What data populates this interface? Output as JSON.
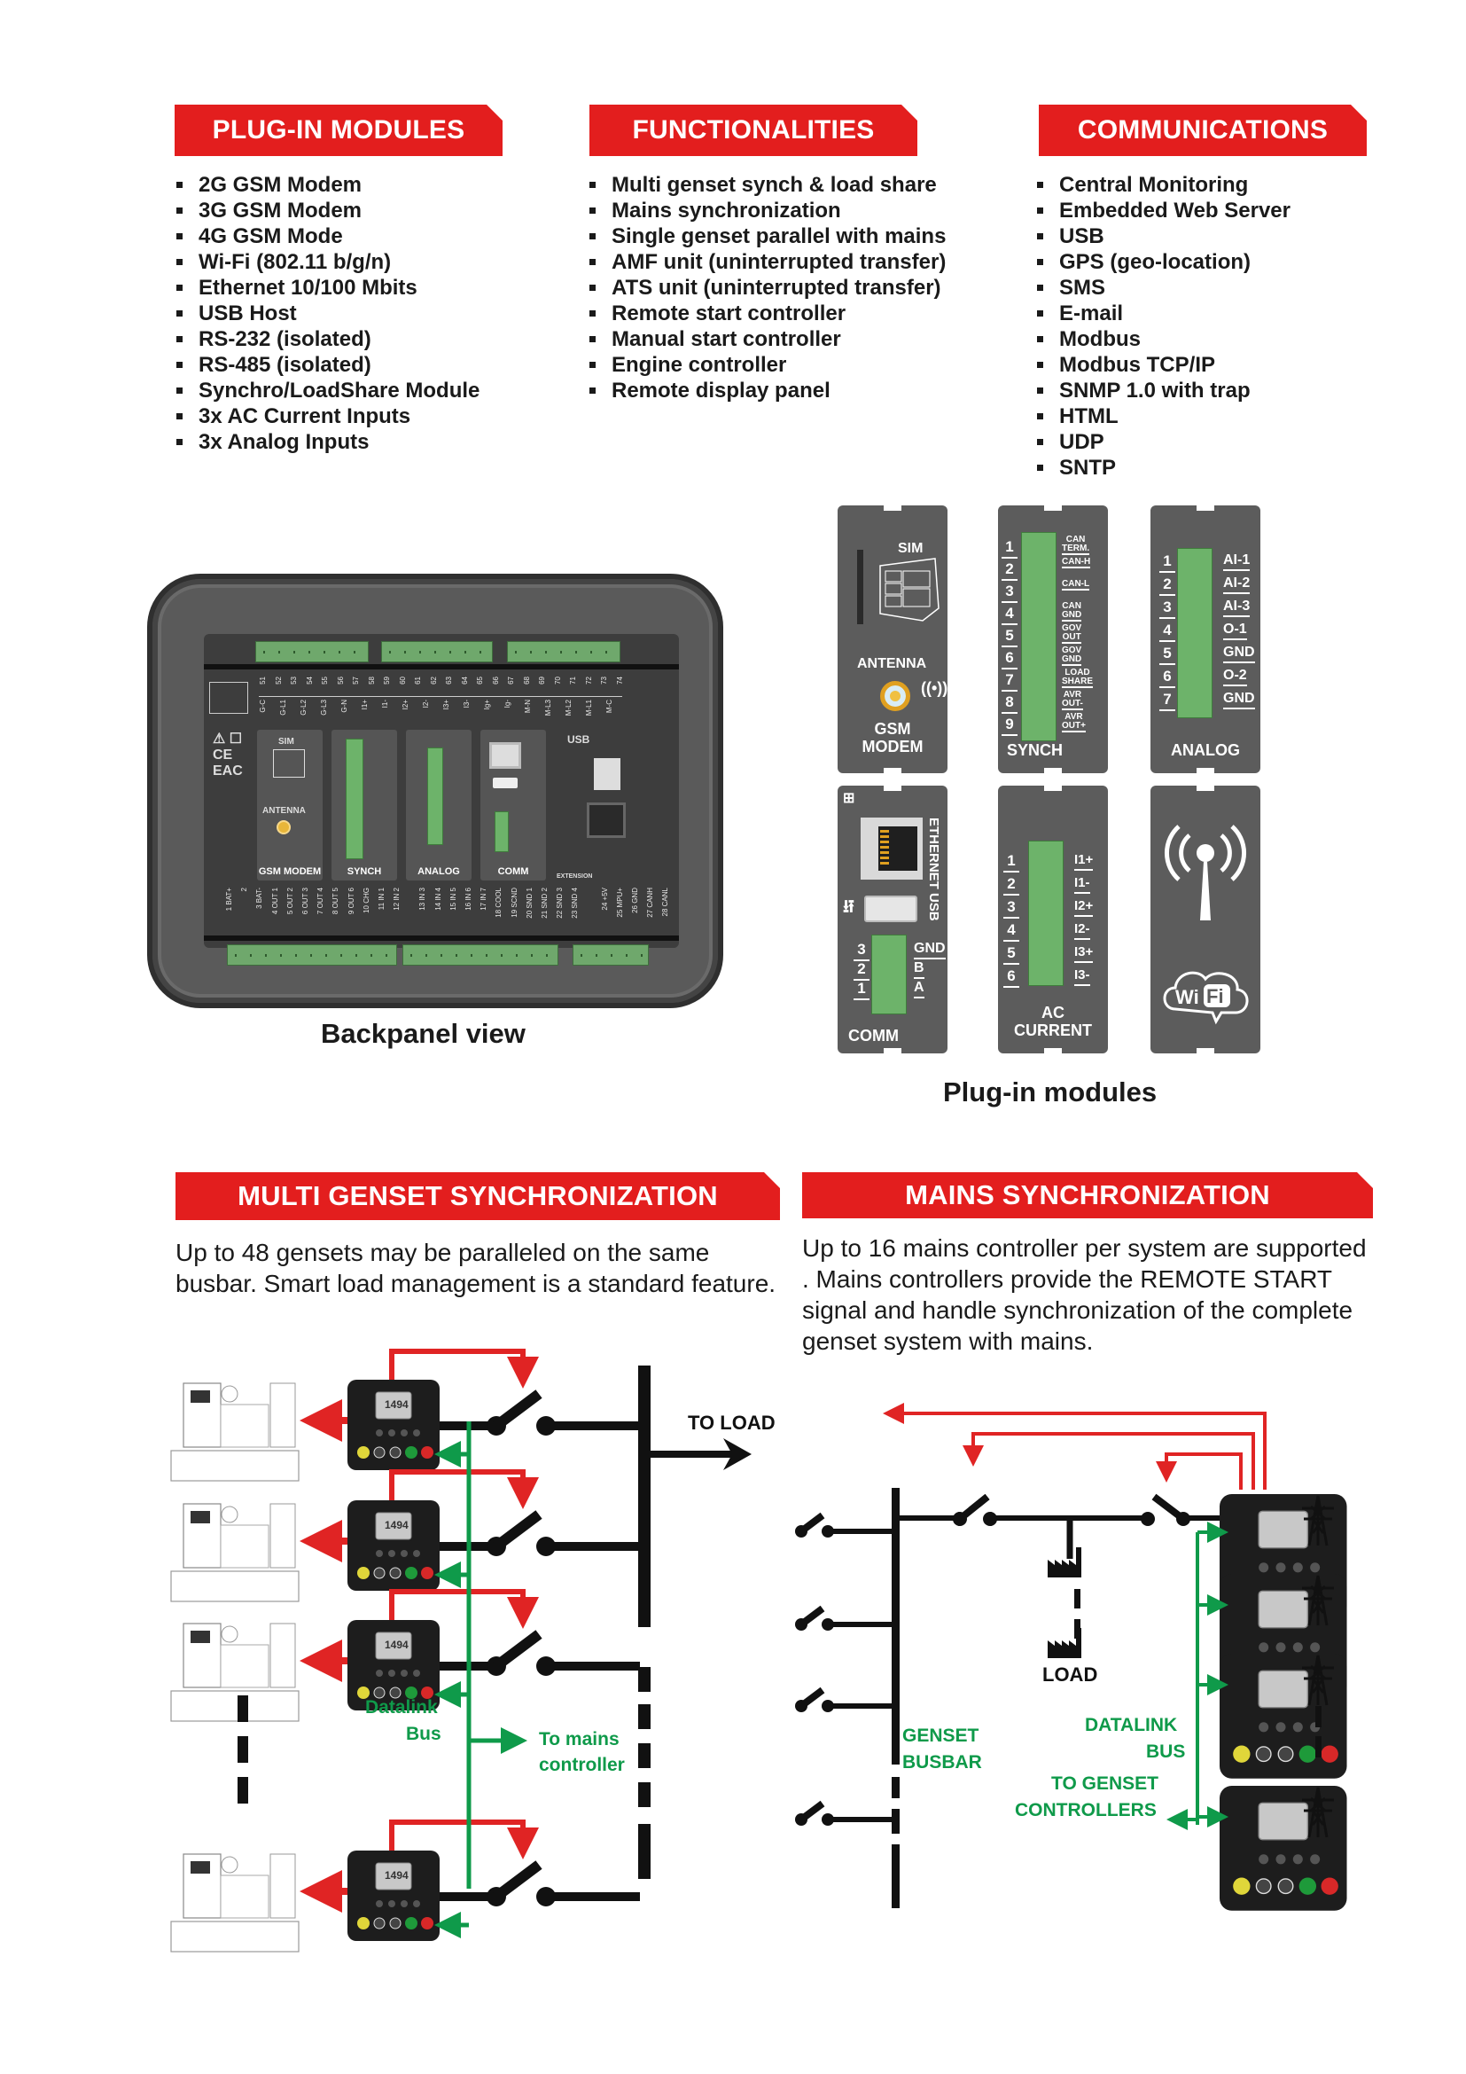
{
  "sections": {
    "plugin_modules": {
      "title": "PLUG-IN MODULES",
      "items": [
        "2G GSM Modem",
        "3G GSM Modem",
        "4G GSM Mode",
        "Wi-Fi (802.11 b/g/n)",
        "Ethernet 10/100 Mbits",
        "USB Host",
        "RS-232 (isolated)",
        "RS-485 (isolated)",
        "Synchro/LoadShare Module",
        "3x AC Current Inputs",
        "3x Analog Inputs"
      ]
    },
    "functionalities": {
      "title": "FUNCTIONALITIES",
      "items": [
        "Multi genset synch & load share",
        "Mains synchronization",
        "Single genset parallel with mains",
        "AMF unit (uninterrupted transfer)",
        "ATS unit (uninterrupted transfer)",
        "Remote start controller",
        "Manual start controller",
        "Engine controller",
        "Remote display panel"
      ]
    },
    "communications": {
      "title": "COMMUNICATIONS",
      "items": [
        "Central Monitoring",
        "Embedded Web Server",
        "USB",
        "GPS (geo-location)",
        "SMS",
        "E-mail",
        "Modbus",
        "Modbus TCP/IP",
        "SNMP 1.0 with trap",
        "HTML",
        "UDP",
        "SNTP"
      ]
    }
  },
  "backpanel": {
    "caption": "Backpanel view",
    "top_pins": [
      "51",
      "52",
      "53",
      "54",
      "55",
      "56",
      "57",
      "58",
      "59",
      "60",
      "61",
      "62",
      "63",
      "64",
      "65",
      "66",
      "67",
      "68",
      "69",
      "70",
      "71",
      "72",
      "73",
      "74"
    ],
    "top_labels": [
      "G-C",
      "G-L1",
      "G-L2",
      "G-L3",
      "G-N",
      "I1+",
      "I1-",
      "I2+",
      "I2-",
      "I3+",
      "I3-",
      "Ig+",
      "Ig-",
      "M-N",
      "M-L3",
      "M-L2",
      "M-L1",
      "M-C"
    ],
    "bottom_labels": [
      "1 BAT+",
      "2",
      "3 BAT-",
      "4 OUT 1",
      "5 OUT 2",
      "6 OUT 3",
      "7 OUT 4",
      "8 OUT 5",
      "9 OUT 6",
      "10 CHG",
      "11 IN 1",
      "12 IN 2",
      "13 IN 3",
      "14 IN 4",
      "15 IN 5",
      "16 IN 6",
      "17 IN 7",
      "18 COOL",
      "19 SCND",
      "20 SND 1",
      "21 SND 2",
      "22 SND 3",
      "23 SND 4",
      "24 +5V",
      "25 MPU+",
      "26 GND",
      "27 CANH",
      "28 CANL"
    ],
    "slots": [
      "GSM MODEM",
      "SYNCH",
      "ANALOG",
      "COMM"
    ],
    "usb_label": "USB",
    "extension_label": "EXTENSION",
    "ethernet_usb_label": "ETHERNET USB",
    "sim_label": "SIM",
    "antenna_label": "ANTENNA"
  },
  "plugin_panels": {
    "caption": "Plug-in modules",
    "gsm": {
      "sim": "SIM",
      "antenna": "ANTENNA",
      "title_1": "GSM",
      "title_2": "MODEM"
    },
    "synch": {
      "title": "SYNCH",
      "pins": [
        "1",
        "2",
        "3",
        "4",
        "5",
        "6",
        "7",
        "8",
        "9"
      ],
      "labels": [
        [
          "CAN",
          "TERM."
        ],
        [
          "CAN-H",
          ""
        ],
        [
          "CAN-L",
          ""
        ],
        [
          "CAN",
          "GND"
        ],
        [
          "GOV",
          "OUT"
        ],
        [
          "GOV",
          "GND"
        ],
        [
          "LOAD",
          "SHARE"
        ],
        [
          "AVR",
          "OUT-"
        ],
        [
          "AVR",
          "OUT+"
        ]
      ]
    },
    "analog": {
      "title": "ANALOG",
      "pins": [
        "1",
        "2",
        "3",
        "4",
        "5",
        "6",
        "7"
      ],
      "labels": [
        "AI-1",
        "AI-2",
        "AI-3",
        "O-1",
        "GND",
        "O-2",
        "GND"
      ]
    },
    "comm": {
      "title": "COMM",
      "side_label": "ETHERNET USB",
      "pins": [
        "3",
        "2",
        "1"
      ],
      "labels": [
        "GND",
        "B",
        "A"
      ]
    },
    "ac_current": {
      "title_1": "AC",
      "title_2": "CURRENT",
      "pins": [
        "1",
        "2",
        "3",
        "4",
        "5",
        "6"
      ],
      "labels": [
        "I1+",
        "I1-",
        "I2+",
        "I2-",
        "I3+",
        "I3-"
      ]
    },
    "wifi": {
      "logo_1": "Wi",
      "logo_2": "Fi"
    }
  },
  "multi_genset": {
    "title": "MULTI GENSET SYNCHRONIZATION",
    "description": "Up to 48 gensets may be paralleled on the same busbar. Smart load management is a standard feature.",
    "diagram": {
      "to_load": "TO LOAD",
      "datalink_1": "Datalink",
      "datalink_2": "Bus",
      "to_mains_1": "To mains",
      "to_mains_2": "controller",
      "controller_display": "1494"
    }
  },
  "mains_sync": {
    "title": "MAINS SYNCHRONIZATION",
    "description": "Up to 16 mains controller per system are supported . Mains controllers provide the REMOTE START signal and handle synchronization of the complete genset system with mains.",
    "diagram": {
      "load": "LOAD",
      "genset_busbar_1": "GENSET",
      "genset_busbar_2": "BUSBAR",
      "datalink_1": "DATALINK",
      "datalink_2": "BUS",
      "to_genset_1": "TO GENSET",
      "to_genset_2": "CONTROLLERS"
    }
  },
  "colors": {
    "banner_red": "#e31e1e",
    "signal_red": "#e02424",
    "datalink_green": "#0f9a4a",
    "terminal_green": "#6db36a",
    "panel_grey": "#5c5c5c"
  }
}
